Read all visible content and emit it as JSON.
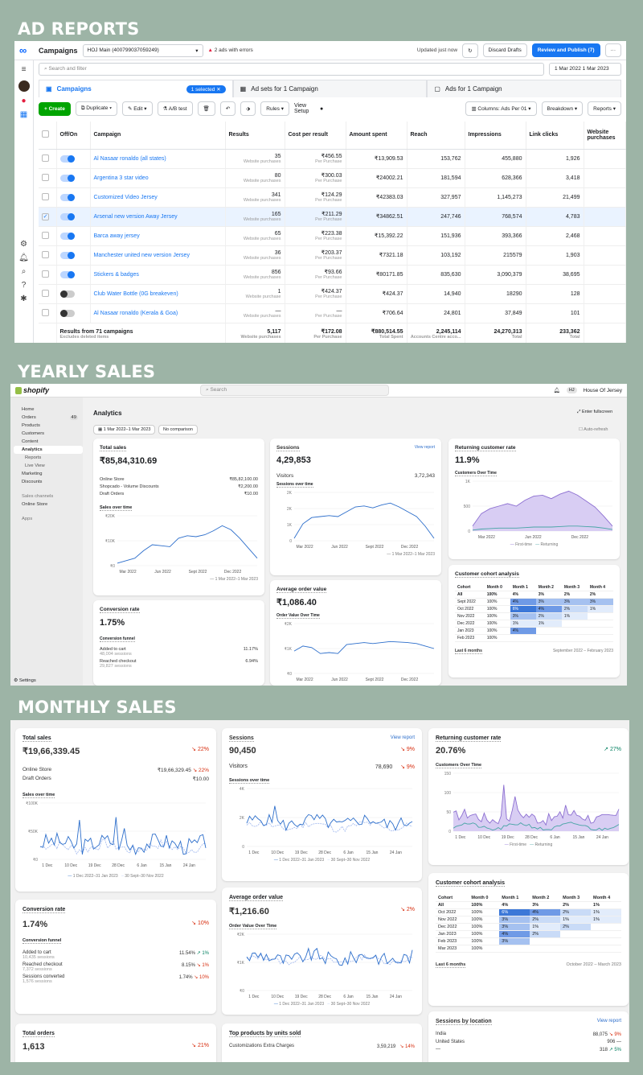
{
  "sections": {
    "ad": "AD REPORTS",
    "yearly": "YEARLY SALES",
    "monthly": "MONTHLY SALES"
  },
  "fb": {
    "title": "Campaigns",
    "account": "HOJ Main (400799037059249)",
    "warn": "2 ads with errors",
    "updated": "Updated just now",
    "discard": "Discard Drafts",
    "review": "Review and Publish (7)",
    "more": "···",
    "search_placeholder": "Search and filter",
    "date": "1 Mar 2022 1 Mar 2023",
    "tabs": [
      {
        "label": "Campaigns",
        "pill": "1 selected"
      },
      {
        "label": "Ad sets for 1 Campaign"
      },
      {
        "label": "Ads for 1 Campaign"
      }
    ],
    "toolbar": {
      "create": "+ Create",
      "duplicate": "Duplicate",
      "edit": "Edit",
      "ab": "A/B test",
      "rules": "Rules",
      "view": "View Setup",
      "columns": "Columns: Ads Per 01",
      "breakdown": "Breakdown",
      "reports": "Reports"
    },
    "headers": [
      "Off/On",
      "Campaign",
      "Results",
      "Cost per result",
      "Amount spent",
      "Reach",
      "Impressions",
      "Link clicks",
      "Website purchases"
    ],
    "rows": [
      {
        "on": true,
        "sel": false,
        "name": "Al Nasaar ronaldo (all states)",
        "res": "35",
        "rsub": "Website purchases",
        "cpr": "₹456.55",
        "csub": "Per Purchase",
        "spent": "₹13,909.53",
        "reach": "153,762",
        "imp": "455,880",
        "clicks": "1,926"
      },
      {
        "on": true,
        "sel": false,
        "name": "Argentina 3 star video",
        "res": "80",
        "rsub": "Website purchases",
        "cpr": "₹300.03",
        "csub": "Per Purchase",
        "spent": "₹24002.21",
        "reach": "181,594",
        "imp": "628,366",
        "clicks": "3,418"
      },
      {
        "on": true,
        "sel": false,
        "name": "Customized Video Jersey",
        "res": "341",
        "rsub": "Website purchases",
        "cpr": "₹124.29",
        "csub": "Per Purchase",
        "spent": "₹42383.03",
        "reach": "327,957",
        "imp": "1,145,273",
        "clicks": "21,499"
      },
      {
        "on": true,
        "sel": true,
        "name": "Arsenal new version Away Jersey",
        "res": "165",
        "rsub": "Website purchases",
        "cpr": "₹211.29",
        "csub": "Per Purchase",
        "spent": "₹34862.51",
        "reach": "247,746",
        "imp": "768,574",
        "clicks": "4,783"
      },
      {
        "on": true,
        "sel": false,
        "name": "Barca away jersey",
        "res": "65",
        "rsub": "Website purchases",
        "cpr": "₹223.38",
        "csub": "Per Purchase",
        "spent": "₹15,392.22",
        "reach": "151,936",
        "imp": "393,366",
        "clicks": "2,468"
      },
      {
        "on": true,
        "sel": false,
        "name": "Manchester united new version Jersey",
        "res": "36",
        "rsub": "Website purchases",
        "cpr": "₹203.37",
        "csub": "Per Purchase",
        "spent": "₹7321.18",
        "reach": "103,192",
        "imp": "215579",
        "clicks": "1,903"
      },
      {
        "on": true,
        "sel": false,
        "name": "Stickers & badges",
        "res": "856",
        "rsub": "Website purchases",
        "cpr": "₹93.66",
        "csub": "Per Purchase",
        "spent": "₹80171.85",
        "reach": "835,630",
        "imp": "3,090,379",
        "clicks": "38,695"
      },
      {
        "on": false,
        "sel": false,
        "name": "Club Water Bottle (0G breakeven)",
        "res": "1",
        "rsub": "Website purchase",
        "cpr": "₹424.37",
        "csub": "Per Purchase",
        "spent": "₹424.37",
        "reach": "14,940",
        "imp": "18290",
        "clicks": "128"
      },
      {
        "on": false,
        "sel": false,
        "name": "Al Nasaar ronaldo (Kerala & Goa)",
        "res": "—",
        "rsub": "Website purchases",
        "cpr": "—",
        "csub": "Per Purchase",
        "spent": "₹706.64",
        "reach": "24,801",
        "imp": "37,849",
        "clicks": "101"
      }
    ],
    "total": {
      "label": "Results from 71 campaigns",
      "sub": "Excludes deleted items",
      "res": "5,117",
      "rsub": "Website purchases",
      "cpr": "₹172.08",
      "csub": "Per Purchase",
      "spent": "₹880,514.55",
      "ssub": "Total Spent",
      "reach": "2,245,114",
      "rsub2": "Accounts Centre acco...",
      "imp": "24,270,313",
      "isub": "Total",
      "clicks": "233,362",
      "lsub": "Total"
    }
  },
  "yearly": {
    "search": "Search",
    "store": "House Of Jersey",
    "store_init": "HJ",
    "page": "Analytics",
    "date": "1 Mar 2022–1 Mar 2023",
    "compare": "No comparison",
    "fullscreen": "Enter fullscreen",
    "autorefresh": "Auto-refresh",
    "nav": [
      {
        "label": "Home"
      },
      {
        "label": "Orders",
        "badge": "49"
      },
      {
        "label": "Products"
      },
      {
        "label": "Customers"
      },
      {
        "label": "Content"
      },
      {
        "label": "Analytics",
        "act": true
      },
      {
        "label": "Reports",
        "child": true
      },
      {
        "label": "Live View",
        "child": true
      },
      {
        "label": "Marketing"
      },
      {
        "label": "Discounts"
      },
      {
        "label": "Sales channels"
      },
      {
        "label": "Online Store"
      },
      {
        "label": "Apps"
      }
    ],
    "settings": "Settings",
    "total_sales": {
      "label": "Total sales",
      "value": "₹85,84,310.69",
      "rows": [
        [
          "Online Store",
          "₹85,82,100.00"
        ],
        [
          "Shopcado - Volume Discounts",
          "₹2,200.00"
        ],
        [
          "Draft Orders",
          "₹10.00"
        ]
      ],
      "chart": "Sales over time",
      "ticks_y": [
        "₹20K",
        "₹10K",
        "₹0"
      ],
      "ticks_x": [
        "Mar 2022",
        "Jun 2022",
        "Sept 2022",
        "Dec 2022"
      ],
      "legend": "1 Mar 2022–1 Mar 2023"
    },
    "sessions": {
      "label": "Sessions",
      "link": "View report",
      "value": "4,29,853",
      "visitors": "Visitors",
      "vval": "3,72,343",
      "chart": "Sessions over time",
      "ticks_y": [
        "2K",
        "2K",
        "1K",
        "0"
      ],
      "ticks_x": [
        "Mar 2022",
        "Jun 2022",
        "Sept 2022",
        "Dec 2022"
      ],
      "legend": "1 Mar 2022–1 Mar 2023"
    },
    "returning": {
      "label": "Returning customer rate",
      "value": "11.9%",
      "chart": "Customers Over Time",
      "ticks_y": [
        "1K",
        "500",
        "0"
      ],
      "ticks_x": [
        "Mar 2022",
        "Jun 2022",
        "Dec 2022"
      ],
      "legend": [
        "First-time",
        "Returning"
      ]
    },
    "conversion": {
      "label": "Conversion rate",
      "value": "1.75%",
      "funnel": "Conversion funnel",
      "rows": [
        [
          "Added to cart",
          "48,004 sessions",
          "11.17%"
        ],
        [
          "Reached checkout",
          "29,827 sessions",
          "6.94%"
        ]
      ]
    },
    "aov": {
      "label": "Average order value",
      "value": "₹1,086.40",
      "chart": "Order Value Over Time",
      "ticks_y": [
        "₹2K",
        "₹1K",
        "₹0"
      ],
      "ticks_x": [
        "Mar 2022",
        "Jun 2022",
        "Sept 2022",
        "Dec 2022"
      ]
    },
    "cohort": {
      "label": "Customer cohort analysis",
      "head": [
        "Cohort",
        "Month 0",
        "Month 1",
        "Month 2",
        "Month 3",
        "Month 4"
      ],
      "rows": [
        [
          "All",
          "100%",
          "4%",
          "3%",
          "2%",
          "2%"
        ],
        [
          "Sept 2022",
          "100%",
          "4%",
          "3%",
          "3%",
          "3%"
        ],
        [
          "Oct 2022",
          "100%",
          "6%",
          "4%",
          "2%",
          "1%"
        ],
        [
          "Nov 2022",
          "100%",
          "3%",
          "2%",
          "1%",
          ""
        ],
        [
          "Dec 2022",
          "100%",
          "1%",
          "1%",
          "",
          ""
        ],
        [
          "Jan 2023",
          "100%",
          "4%",
          "",
          "",
          ""
        ],
        [
          "Feb 2023",
          "100%",
          "",
          "",
          "",
          ""
        ]
      ],
      "foot": "Last 6 months",
      "range": "September 2022 – February 2023"
    }
  },
  "monthly": {
    "total_sales": {
      "label": "Total sales",
      "value": "₹19,66,339.45",
      "delta": "22%",
      "rows": [
        [
          "Online Store",
          "₹19,66,329.45",
          "22%"
        ],
        [
          "Draft Orders",
          "₹10.00",
          ""
        ]
      ],
      "chart": "Sales over time",
      "ticks_y": [
        "₹100K",
        "₹50K",
        "₹0"
      ],
      "ticks_x": [
        "1 Dec",
        "10 Dec",
        "19 Dec",
        "28 Dec",
        "6 Jan",
        "15 Jan",
        "24 Jan"
      ],
      "legend": [
        "1 Dec 2022–31 Jan 2023",
        "30 Sept–30 Nov 2022"
      ]
    },
    "sessions": {
      "label": "Sessions",
      "link": "View report",
      "value": "90,450",
      "delta": "9%",
      "visitors": "Visitors",
      "vval": "78,690",
      "vdelta": "9%",
      "chart": "Sessions over time",
      "ticks_y": [
        "4K",
        "2K",
        "0"
      ],
      "ticks_x": [
        "1 Dec",
        "10 Dec",
        "19 Dec",
        "28 Dec",
        "6 Jan",
        "15 Jan",
        "24 Jan"
      ],
      "legend": [
        "1 Dec 2022–31 Jan 2023",
        "30 Sept–30 Nov 2022"
      ]
    },
    "returning": {
      "label": "Returning customer rate",
      "value": "20.76%",
      "delta": "27%",
      "chart": "Customers Over Time",
      "ticks_y": [
        "150",
        "100",
        "50",
        "0"
      ],
      "ticks_x": [
        "1 Dec",
        "10 Dec",
        "19 Dec",
        "28 Dec",
        "6 Jan",
        "15 Jan",
        "24 Jan"
      ],
      "legend": [
        "First-time",
        "Returning"
      ]
    },
    "conversion": {
      "label": "Conversion rate",
      "value": "1.74%",
      "delta": "10%",
      "funnel": "Conversion funnel",
      "rows": [
        [
          "Added to cart",
          "10,435 sessions",
          "11.54%",
          "1%",
          "up"
        ],
        [
          "Reached checkout",
          "7,372 sessions",
          "8.15%",
          "1%",
          "down"
        ],
        [
          "Sessions converted",
          "1,576 sessions",
          "1.74%",
          "10%",
          "down"
        ]
      ]
    },
    "aov": {
      "label": "Average order value",
      "value": "₹1,216.60",
      "delta": "2%",
      "chart": "Order Value Over Time",
      "ticks_y": [
        "₹2K",
        "₹1K",
        "₹0"
      ],
      "ticks_x": [
        "1 Dec",
        "10 Dec",
        "19 Dec",
        "28 Dec",
        "6 Jan",
        "15 Jan",
        "24 Jan"
      ],
      "legend": [
        "1 Dec 2022–31 Jan 2023",
        "30 Sept–30 Nov 2022"
      ]
    },
    "cohort": {
      "label": "Customer cohort analysis",
      "head": [
        "Cohort",
        "Month 0",
        "Month 1",
        "Month 2",
        "Month 3",
        "Month 4"
      ],
      "rows": [
        [
          "All",
          "100%",
          "4%",
          "3%",
          "2%",
          "1%"
        ],
        [
          "Oct 2022",
          "100%",
          "6%",
          "4%",
          "2%",
          "1%"
        ],
        [
          "Nov 2022",
          "100%",
          "3%",
          "2%",
          "1%",
          "1%"
        ],
        [
          "Dec 2022",
          "100%",
          "3%",
          "1%",
          "2%",
          ""
        ],
        [
          "Jan 2023",
          "100%",
          "4%",
          "2%",
          "",
          ""
        ],
        [
          "Feb 2023",
          "100%",
          "3%",
          "",
          "",
          ""
        ],
        [
          "Mar 2023",
          "100%",
          "",
          "",
          "",
          ""
        ]
      ],
      "foot": "Last 6 months",
      "range": "October 2022 – March 2023"
    },
    "orders": {
      "label": "Total orders",
      "value": "1,613",
      "delta": "21%"
    },
    "products": {
      "label": "Top products by units sold",
      "rows": [
        [
          "Customizations Extra Charges",
          "3,59,219",
          "14%"
        ]
      ]
    },
    "location": {
      "label": "Sessions by location",
      "link": "View report",
      "rows": [
        [
          "India",
          "88,075",
          "9%",
          "down"
        ],
        [
          "United States",
          "906",
          "—",
          ""
        ],
        [
          "—",
          "318",
          "5%",
          "up"
        ]
      ]
    }
  }
}
